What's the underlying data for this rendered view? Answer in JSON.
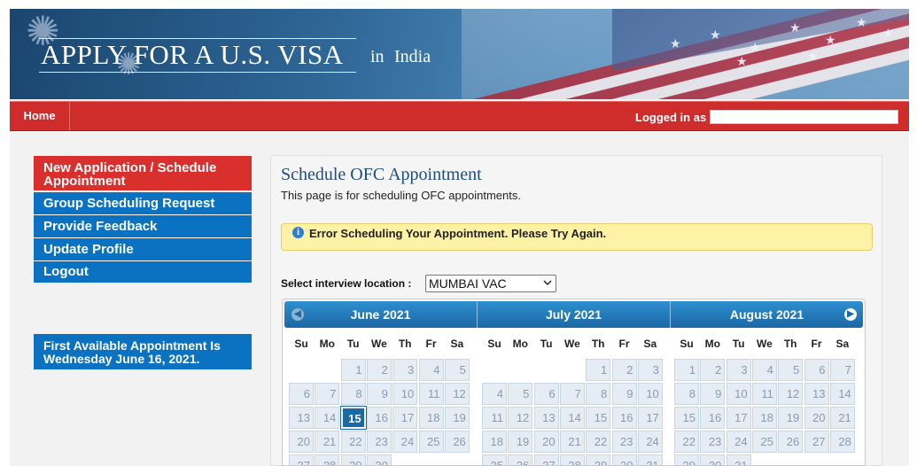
{
  "colors": {
    "nav_red": "#cf2c2c",
    "menu_blue": "#0a72c0",
    "menu_active_red": "#d9302e",
    "calendar_header": "#1c67a5",
    "alert_bg": "#fdf2a6"
  },
  "header": {
    "title": "APPLY FOR A U.S. VISA",
    "country_prefix": "in",
    "country": "India"
  },
  "nav": {
    "home": "Home",
    "logged_in_label": "Logged in as",
    "logged_in_value": ""
  },
  "sidebar": {
    "items": [
      {
        "label": "New Application / Schedule Appointment",
        "active": true
      },
      {
        "label": "Group Scheduling Request",
        "active": false
      },
      {
        "label": "Provide Feedback",
        "active": false
      },
      {
        "label": "Update Profile",
        "active": false
      },
      {
        "label": "Logout",
        "active": false
      }
    ],
    "first_available": "First Available Appointment Is Wednesday June 16, 2021."
  },
  "main": {
    "title": "Schedule OFC Appointment",
    "description": "This page is for scheduling OFC appointments.",
    "alert_icon": "info-icon",
    "alert": "Error Scheduling Your Appointment. Please Try Again.",
    "location_label": "Select interview location :",
    "location_value": "MUMBAI VAC"
  },
  "calendar": {
    "prev_icon": "chevron-left-icon",
    "next_icon": "chevron-right-icon",
    "weekdays": [
      "Su",
      "Mo",
      "Tu",
      "We",
      "Th",
      "Fr",
      "Sa"
    ],
    "months": [
      {
        "label": "June 2021",
        "first_weekday": 2,
        "days": 30,
        "selected": 15
      },
      {
        "label": "July 2021",
        "first_weekday": 4,
        "days": 31,
        "selected": null
      },
      {
        "label": "August 2021",
        "first_weekday": 0,
        "days": 31,
        "selected": null
      }
    ]
  }
}
